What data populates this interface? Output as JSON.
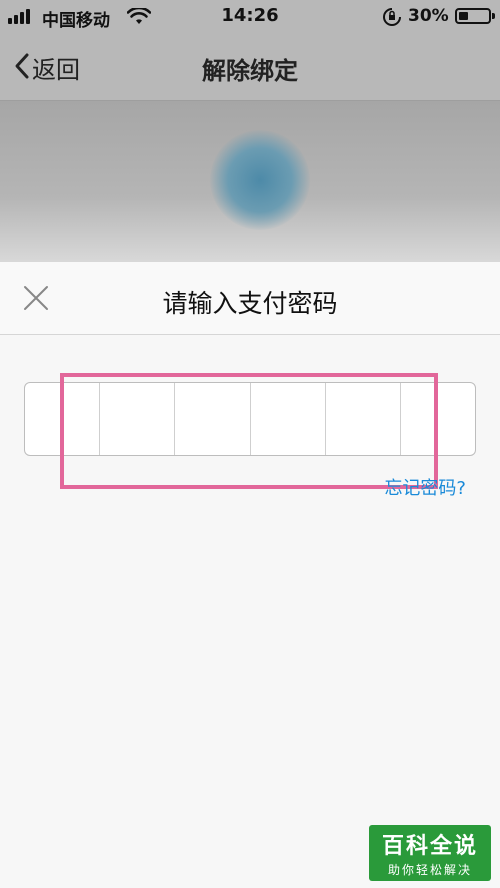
{
  "status_bar": {
    "carrier": "中国移动",
    "time": "14:26",
    "battery": "30%"
  },
  "nav": {
    "back_label": "返回",
    "title": "解除绑定"
  },
  "sheet": {
    "title": "请输入支付密码",
    "forgot_link": "忘记密码?",
    "password_cells": 6
  },
  "watermark": {
    "title": "百科全说",
    "subtitle": "助你轻松解决"
  },
  "colors": {
    "highlight": "#e2679a",
    "link": "#1a8ad8",
    "watermark_bg": "#2a9a3a"
  }
}
